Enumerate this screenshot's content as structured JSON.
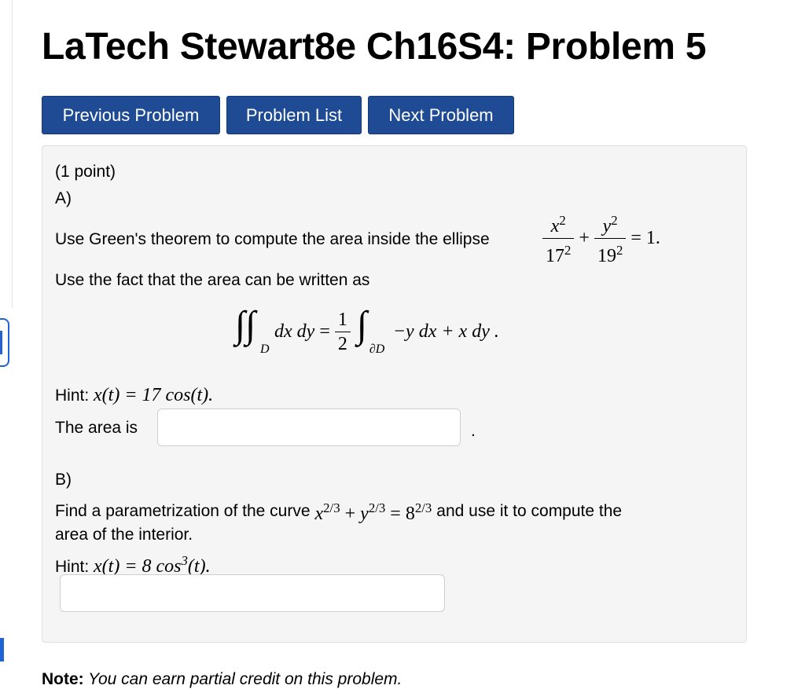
{
  "page": {
    "title": "LaTech Stewart8e Ch16S4: Problem 5"
  },
  "nav": {
    "previous": "Previous Problem",
    "list": "Problem List",
    "next": "Next Problem"
  },
  "problem": {
    "points": "(1 point)",
    "part_a": {
      "label": "A)",
      "prompt": "Use Green's theorem to compute the area inside the ellipse",
      "ellipse": {
        "x_num": "x",
        "x_den": "17",
        "y_num": "y",
        "y_den": "19",
        "exp": "2",
        "plus": "+",
        "rhs": "= 1."
      },
      "fact": "Use the fact that the area can be written as",
      "formula": {
        "lhs": "dx dy",
        "region": "D",
        "eq": "=",
        "half_num": "1",
        "half_den": "2",
        "boundary": "∂D",
        "integrand": "−y dx + x dy ."
      },
      "hint_label": "Hint:",
      "hint_math": "x(t) = 17 cos(t).",
      "answer_label": "The area is",
      "answer_value": "",
      "answer_suffix": "."
    },
    "part_b": {
      "label": "B)",
      "prompt_1": "Find a parametrization of the curve",
      "curve": {
        "lhs1": "x",
        "plus": "+",
        "lhs2": "y",
        "exp": "2/3",
        "eq": "=",
        "rhs": "8"
      },
      "prompt_2": "and use it to compute the",
      "prompt_3": "area of the interior.",
      "hint_label": "Hint:",
      "hint_math": {
        "lhs": "x(t) = 8 cos",
        "exp": "3",
        "rhs": "(t)."
      },
      "answer_value": ""
    }
  },
  "note": {
    "label": "Note:",
    "text": "You can earn partial credit on this problem."
  },
  "colors": {
    "button_bg": "#1e4b93",
    "panel_bg": "#f5f5f5",
    "accent": "#1f63d6"
  }
}
